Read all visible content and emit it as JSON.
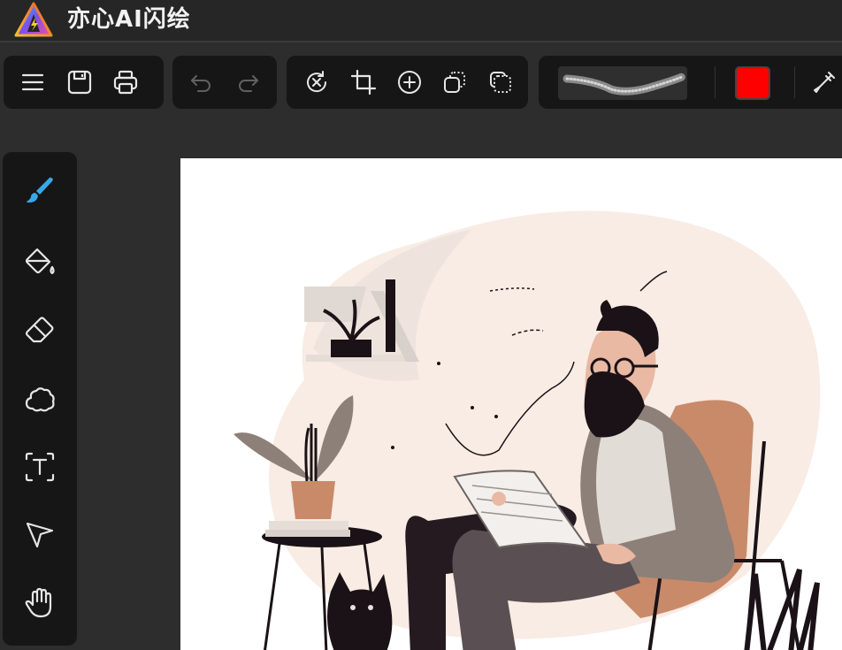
{
  "app": {
    "title": "亦心AI闪绘",
    "logo_icon": "prism-lightning-logo"
  },
  "toolbar": {
    "file_group": [
      {
        "id": "menu",
        "icon": "menu-icon",
        "tooltip": ""
      },
      {
        "id": "save",
        "icon": "save-icon",
        "tooltip": ""
      },
      {
        "id": "print",
        "icon": "printer-icon",
        "tooltip": ""
      }
    ],
    "history_group": [
      {
        "id": "undo",
        "icon": "undo-icon",
        "enabled": false
      },
      {
        "id": "redo",
        "icon": "redo-icon",
        "enabled": false
      }
    ],
    "edit_group": [
      {
        "id": "clear",
        "icon": "reset-clear-icon"
      },
      {
        "id": "crop",
        "icon": "crop-icon"
      },
      {
        "id": "add",
        "icon": "plus-circle-icon"
      },
      {
        "id": "layer-front",
        "icon": "layer-front-icon"
      },
      {
        "id": "layer-back",
        "icon": "layer-back-icon"
      }
    ],
    "brush": {
      "preview_icon": "brush-stroke-preview",
      "color": "#ff0000",
      "eyedropper_icon": "eyedropper-icon"
    }
  },
  "side_tools": [
    {
      "id": "brush",
      "icon": "brush-icon",
      "active": true
    },
    {
      "id": "fill",
      "icon": "paint-bucket-icon",
      "active": false
    },
    {
      "id": "eraser",
      "icon": "eraser-icon",
      "active": false
    },
    {
      "id": "shape",
      "icon": "cloud-shape-icon",
      "active": false
    },
    {
      "id": "text",
      "icon": "text-tool-icon",
      "active": false
    },
    {
      "id": "select",
      "icon": "pointer-arrow-icon",
      "active": false
    },
    {
      "id": "pan",
      "icon": "hand-icon",
      "active": false
    }
  ],
  "colors": {
    "active_tool": "#3aa7e8",
    "icon": "#e6e6e6",
    "brush_color": "#ff0000"
  },
  "canvas": {
    "content": "illustration-man-reading-in-chair"
  }
}
